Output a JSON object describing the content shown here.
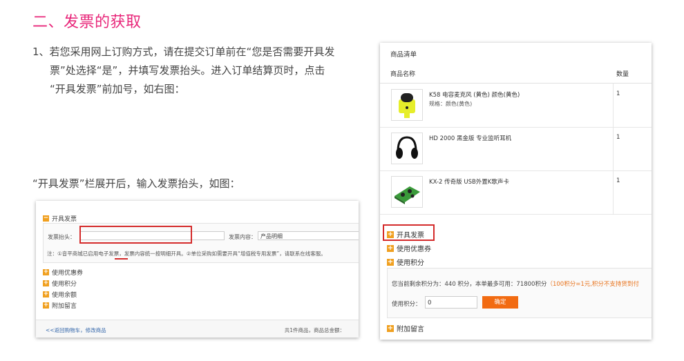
{
  "heading": "二、发票的获取",
  "para1": {
    "line1": "1、若您采用网上订购方式，请在提交订单前在“您是否需要开具发",
    "line2": "票”处选择“是”，并填写发票抬头。进入订单结算页时，点击",
    "line3": "“开具发票”前加号，如右图："
  },
  "para2": "“开具发票”栏展开后，输入发票抬头，如图：",
  "shot1": {
    "section_title": "开具发票",
    "toggle_minus": "−",
    "toggle_plus": "+",
    "title_label": "发票抬头：",
    "title_value": "",
    "content_label": "发票内容：",
    "content_value": "产品明细",
    "note": "注：①音平商城已启用电子发票，发票内容统一按明细开具。②单位采购如需要开具“增值税专用发票”，请联系在线客服。",
    "options": [
      "使用优惠券",
      "使用积分",
      "使用余额",
      "附加留言"
    ],
    "back_link": "<<返回购物车，修改商品",
    "total": "共1件商品，商品总金额："
  },
  "shot2": {
    "header": "商品清单",
    "col_name": "商品名称",
    "col_qty": "数量",
    "products": [
      {
        "name": "K58 电容麦克风 (黄色)  颜色(黄色)",
        "spec": "规格：颜色(黄色)",
        "qty": "1"
      },
      {
        "name": "HD 2000 黑金版 专业监听耳机",
        "spec": "",
        "qty": "1"
      },
      {
        "name": "KX-2 传奇版 USB外置K歌声卡",
        "spec": "",
        "qty": "1"
      }
    ],
    "toggle_plus": "+",
    "options": [
      "开具发票",
      "使用优惠券",
      "使用积分"
    ],
    "points_text": "您当前剩余积分为：440 积分，本单最多可用：71800积分",
    "points_rule": "（100积分=1元,积分不支持货到付",
    "use_label": "使用积分：",
    "use_value": "0",
    "confirm": "确定",
    "last_option": "附加留言"
  },
  "colors": {
    "heading": "#e8277a",
    "accent_orange": "#f0a020",
    "button": "#f26b12",
    "highlight": "#d42a2a"
  }
}
